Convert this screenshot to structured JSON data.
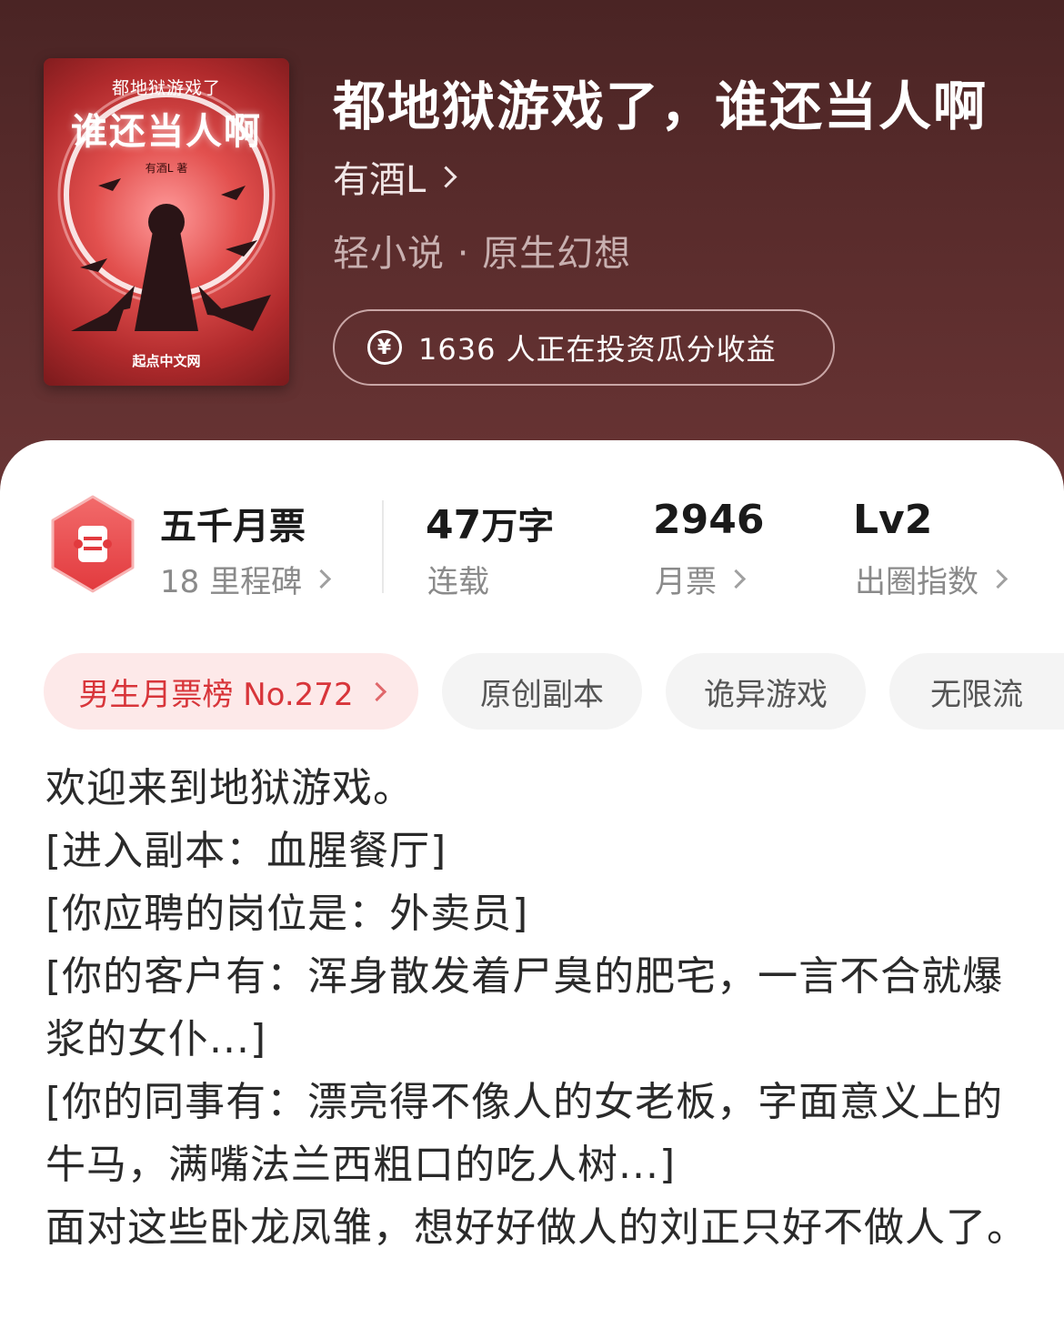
{
  "book": {
    "title": "都地狱游戏了，谁还当人啊",
    "author": "有酒L",
    "genre": "轻小说 · 原生幻想",
    "invest_text": "1636 人正在投资瓜分收益",
    "cover": {
      "subtitle": "都地狱游戏了",
      "title": "谁还当人啊",
      "author": "有酒L 著",
      "publisher": "起点中文网"
    }
  },
  "stats": {
    "milestone_title": "五千月票",
    "milestone_sub": "18 里程碑",
    "words_value": "47",
    "words_unit": "万字",
    "words_label": "连载",
    "votes_value": "2946",
    "votes_label": "月票",
    "level_value": "Lv2",
    "level_label": "出圈指数"
  },
  "tags": [
    "男生月票榜 No.272",
    "原创副本",
    "诡异游戏",
    "无限流"
  ],
  "description": [
    "欢迎来到地狱游戏。",
    "[进入副本：血腥餐厅]",
    "[你应聘的岗位是：外卖员]",
    "[你的客户有：浑身散发着尸臭的肥宅，一言不合就爆浆的女仆...]",
    "[你的同事有：漂亮得不像人的女老板，字面意义上的牛马，满嘴法兰西粗口的吃人树...]",
    "面对这些卧龙凤雏，想好好做人的刘正只好不做人了。"
  ],
  "colors": {
    "header_bg": "#4a2424",
    "accent_red": "#d8353a",
    "tag_rank_bg": "#fde9e9",
    "tag_bg": "#f4f4f4"
  },
  "icons": [
    "yuan-icon",
    "chevron-right-icon",
    "ticket-badge-icon"
  ]
}
